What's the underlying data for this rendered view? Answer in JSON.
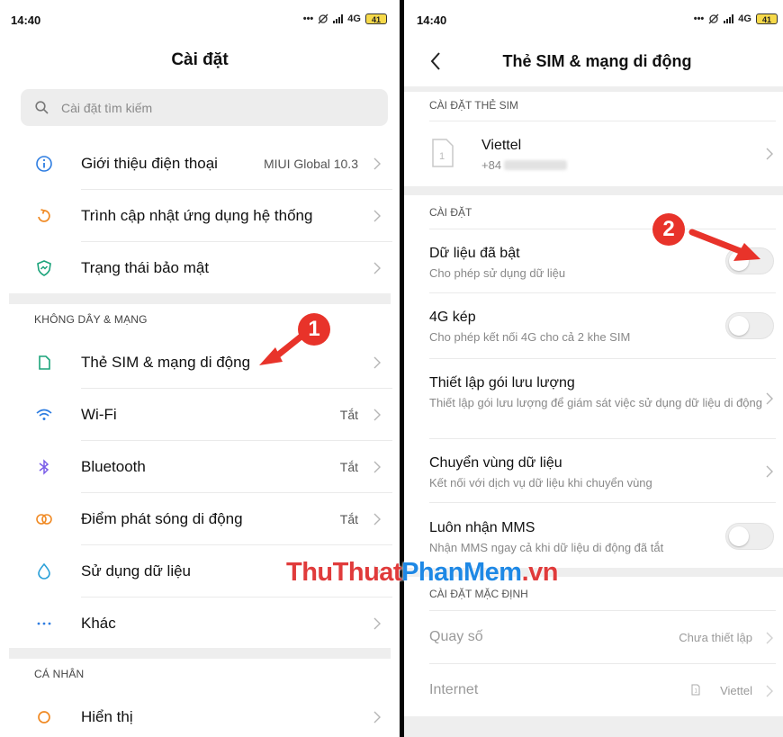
{
  "left": {
    "status": {
      "time": "14:40",
      "network": "4G",
      "battery": "41"
    },
    "title": "Cài đặt",
    "search": {
      "placeholder": "Cài đặt tìm kiếm",
      "icon": "search-icon"
    },
    "top_items": [
      {
        "label": "Giới thiệu điện thoại",
        "value": "MIUI Global 10.3",
        "icon": "info-icon",
        "color": "#2e7de1"
      },
      {
        "label": "Trình cập nhật ứng dụng hệ thống",
        "value": "",
        "icon": "update-icon",
        "color": "#f08a24"
      },
      {
        "label": "Trạng thái bảo mật",
        "value": "",
        "icon": "shield-icon",
        "color": "#1aa37a"
      }
    ],
    "section_network": "KHÔNG DÂY & MẠNG",
    "network_items": [
      {
        "label": "Thẻ SIM & mạng di động",
        "value": "",
        "icon": "sim-card-icon",
        "color": "#1aa37a"
      },
      {
        "label": "Wi-Fi",
        "value": "Tắt",
        "icon": "wifi-icon",
        "color": "#2e7de1"
      },
      {
        "label": "Bluetooth",
        "value": "Tắt",
        "icon": "bluetooth-icon",
        "color": "#7a5de8"
      },
      {
        "label": "Điểm phát sóng di động",
        "value": "Tắt",
        "icon": "hotspot-icon",
        "color": "#f08a24"
      },
      {
        "label": "Sử dụng dữ liệu",
        "value": "",
        "icon": "data-usage-icon",
        "color": "#2aa0d8"
      },
      {
        "label": "Khác",
        "value": "",
        "icon": "more-dots-icon",
        "color": "#2e7de1"
      }
    ],
    "section_personal": "CÁ NHÂN",
    "personal_items": [
      {
        "label": "Hiển thị",
        "value": "",
        "icon": "display-icon",
        "color": "#f08a24"
      }
    ],
    "annotation": "1"
  },
  "right": {
    "status": {
      "time": "14:40",
      "network": "4G",
      "battery": "41"
    },
    "title": "Thẻ SIM & mạng di động",
    "section_sim": "CÀI ĐẶT THẺ SIM",
    "sim": {
      "carrier": "Viettel",
      "number": "+84"
    },
    "section_settings": "CÀI ĐẶT",
    "settings": [
      {
        "title": "Dữ liệu đã bật",
        "subtitle": "Cho phép sử dụng dữ liệu",
        "control": "toggle",
        "on": false
      },
      {
        "title": "4G kép",
        "subtitle": "Cho phép kết nối 4G cho cả 2 khe SIM",
        "control": "toggle",
        "on": false
      },
      {
        "title": "Thiết lập gói lưu lượng",
        "subtitle": "Thiết lập gói lưu lượng để giám sát việc sử dụng dữ liệu di động",
        "control": "chevron"
      },
      {
        "title": "Chuyển vùng dữ liệu",
        "subtitle": "Kết nối với dịch vụ dữ liệu khi chuyển vùng",
        "control": "chevron"
      },
      {
        "title": "Luôn nhận MMS",
        "subtitle": "Nhận MMS ngay cả khi dữ liệu di động đã tắt",
        "control": "toggle",
        "on": false
      }
    ],
    "section_default": "CÀI ĐẶT MẶC ĐỊNH",
    "defaults": [
      {
        "title": "Quay số",
        "value": "Chưa thiết lập"
      },
      {
        "title": "Internet",
        "value": "Viettel",
        "value_icon": "sim-1-icon"
      }
    ],
    "annotation": "2"
  },
  "watermark": {
    "part1": "ThuThuat",
    "part2": "PhanMem",
    "part3": ".vn"
  },
  "colors": {
    "annotation": "#e8332a",
    "divider": "#050505",
    "band": "#eeeeee"
  }
}
